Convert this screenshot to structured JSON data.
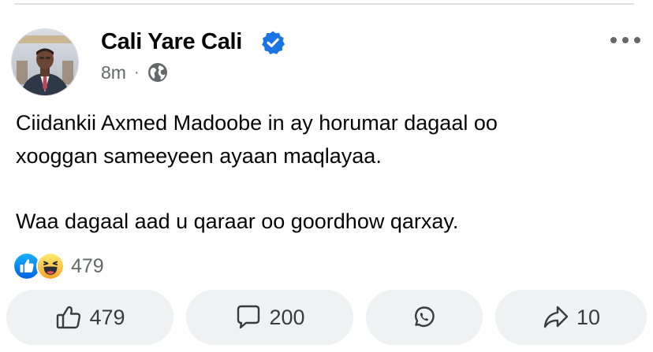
{
  "post": {
    "author": {
      "name": "Cali Yare Cali",
      "verified": true,
      "avatar_icon": "profile-photo"
    },
    "timestamp": "8m",
    "separator": "·",
    "privacy_icon": "globe-icon",
    "more_icon": "ellipsis-icon",
    "text_lines": [
      "Ciidankii Axmed Madoobe in ay horumar dagaal oo",
      "xooggan sameeyeen ayaan maqlayaa.",
      "Waa dagaal aad u qaraar oo goordhow qarxay."
    ]
  },
  "reactions": {
    "types": [
      "like",
      "haha"
    ],
    "count": "479"
  },
  "actions": {
    "like": {
      "icon": "thumbs-up-icon",
      "count": "479"
    },
    "comment": {
      "icon": "comment-icon",
      "count": "200"
    },
    "whatsapp": {
      "icon": "whatsapp-icon"
    },
    "share": {
      "icon": "share-icon",
      "count": "10"
    }
  },
  "colors": {
    "text_primary": "#050505",
    "text_secondary": "#65676b",
    "verified_blue": "#1b74e4",
    "like_blue": "#1877f2",
    "haha_yellow": "#f7b125",
    "button_bg": "#eff1f3",
    "divider": "#dcdfe3"
  }
}
